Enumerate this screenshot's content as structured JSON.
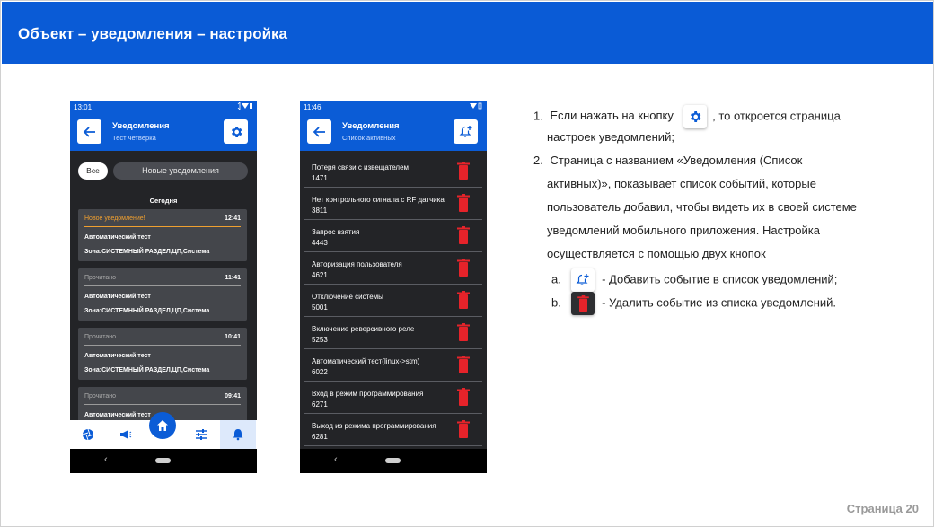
{
  "slide": {
    "title": "Объект – уведомления – настройка",
    "page_number": "Страница 20",
    "colors": {
      "header": "#0a5bd6",
      "accent": "#0b5cd6",
      "delete": "#e5232a",
      "new_status": "#f0a030"
    }
  },
  "phone1": {
    "status_time": "13:01",
    "title": "Уведомления",
    "subtitle": "Тест четвёрка",
    "action_icon": "gear-icon",
    "filter_all": "Все",
    "filter_new": "Новые уведомления",
    "section": "Сегодня",
    "notifications": [
      {
        "status": "Новое уведомление!",
        "time": "12:41",
        "title": "Автоматический тест",
        "zone": "Зона:СИСТЕМНЫЙ РАЗДЕЛ,ЦП,Система"
      },
      {
        "status": "Прочитано",
        "time": "11:41",
        "title": "Автоматический тест",
        "zone": "Зона:СИСТЕМНЫЙ РАЗДЕЛ,ЦП,Система"
      },
      {
        "status": "Прочитано",
        "time": "10:41",
        "title": "Автоматический тест",
        "zone": "Зона:СИСТЕМНЫЙ РАЗДЕЛ,ЦП,Система"
      },
      {
        "status": "Прочитано",
        "time": "09:41",
        "title": "Автоматический тест",
        "zone": ""
      }
    ],
    "bottom_nav": [
      "aperture-icon",
      "megaphone-icon",
      "home-icon",
      "sliders-icon",
      "bell-icon"
    ]
  },
  "phone2": {
    "status_time": "11:46",
    "title": "Уведомления",
    "subtitle": "Список активных",
    "action_icon": "bell-add-icon",
    "events": [
      {
        "name": "Потеря связи с извещателем",
        "code": "1471"
      },
      {
        "name": "Нет контрольного сигнала с RF датчика",
        "code": "3811"
      },
      {
        "name": "Запрос взятия",
        "code": "4443"
      },
      {
        "name": "Авторизация пользователя",
        "code": "4621"
      },
      {
        "name": "Отключение системы",
        "code": "5001"
      },
      {
        "name": "Включение реверсивного реле",
        "code": "5253"
      },
      {
        "name": "Автоматический тест(linux->stm)",
        "code": "6022"
      },
      {
        "name": "Вход в режим программирования",
        "code": "6271"
      },
      {
        "name": "Выход из режима программирования",
        "code": "6281"
      }
    ]
  },
  "instructions": {
    "item1_num": "1.",
    "item1_pre": "Если нажать на кнопку",
    "item1_post": ", то откроется страница",
    "item1_line2": "настроек уведомлений;",
    "item2_num": "2.",
    "item2_lines": [
      "Страница с названием «Уведомления (Список",
      "активных)», показывает список событий, которые",
      "пользователь добавил, чтобы видеть их в своей системе",
      "уведомлений мобильного приложения. Настройка",
      "осуществляется с помощью двух кнопок"
    ],
    "sub_a_marker": "a.",
    "sub_a_text": "- Добавить событие в список уведомлений;",
    "sub_b_marker": "b.",
    "sub_b_text": "- Удалить событие из списка уведомлений."
  }
}
